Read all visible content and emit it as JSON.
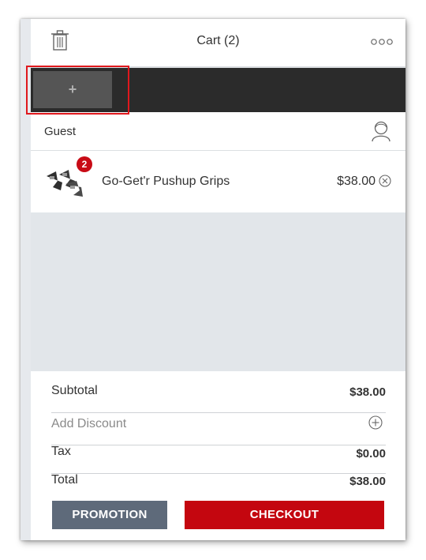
{
  "header": {
    "title": "Cart (2)",
    "trash_icon": "trash-icon",
    "more_icon": "more-options-icon"
  },
  "tabs": {
    "add_label": "+"
  },
  "customer": {
    "name": "Guest",
    "icon": "customer-profile-icon"
  },
  "cart_items": [
    {
      "name": "Go-Get'r Pushup Grips",
      "price": "$38.00",
      "quantity": "2"
    }
  ],
  "totals": {
    "subtotal_label": "Subtotal",
    "subtotal_value": "$38.00",
    "discount_label": "Add Discount",
    "tax_label": "Tax",
    "tax_value": "$0.00",
    "total_label": "Total",
    "total_value": "$38.00"
  },
  "buttons": {
    "promotion": "PROMOTION",
    "checkout": "CHECKOUT"
  },
  "colors": {
    "checkout": "#c4060f",
    "promotion": "#5e6a7a",
    "tabbar": "#2b2b2b",
    "badge": "#c80b16",
    "highlight": "#e0181d"
  }
}
